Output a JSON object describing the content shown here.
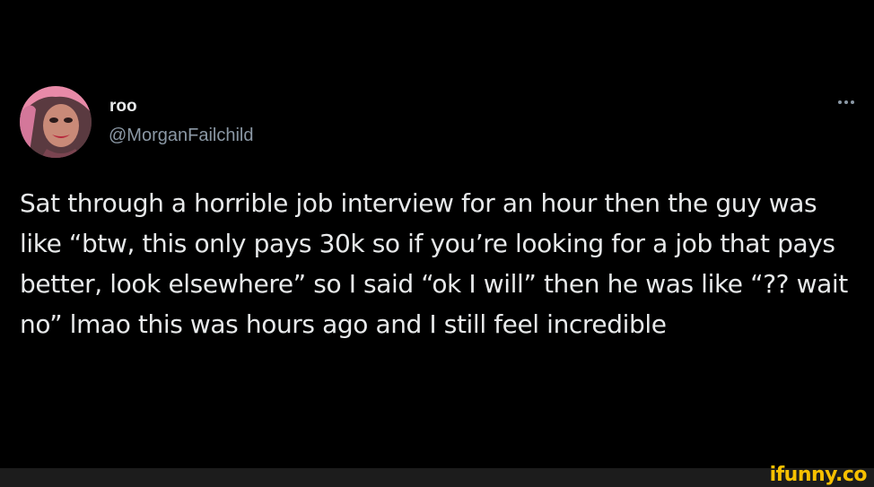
{
  "tweet": {
    "display_name": "roo",
    "handle": "@MorganFailchild",
    "text": "Sat through a horrible job interview for an hour then the guy was like “btw, this only pays 30k so if you’re looking for a job that pays better, look elsewhere” so I said “ok I will” then he was like “?? wait no” lmao this was hours ago and I still feel incredible",
    "more_icon": "more-horizontal-icon"
  },
  "watermark": {
    "text": "ifunny.co"
  },
  "colors": {
    "background": "#000000",
    "primary_text": "#e7e9ea",
    "secondary_text": "#8b98a5",
    "watermark": "#f6c000"
  }
}
